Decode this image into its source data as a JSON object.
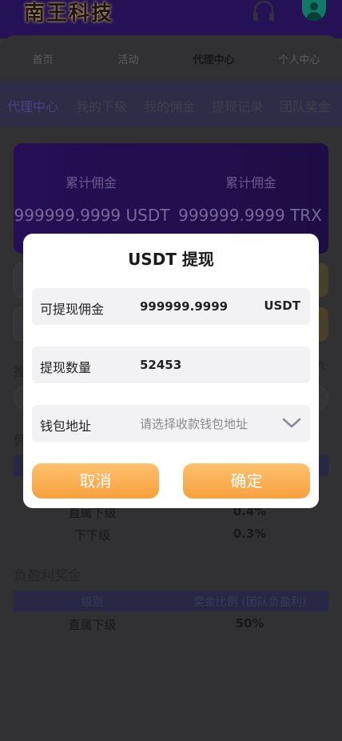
{
  "header": {
    "logo_text": "南王科技",
    "support_icon": "headset-icon",
    "avatar_icon": "user-avatar-icon"
  },
  "nav": {
    "items": [
      {
        "label": "首页"
      },
      {
        "label": "活动"
      },
      {
        "label": "代理中心",
        "active": true
      },
      {
        "label": "个人中心"
      }
    ]
  },
  "subtabs": {
    "items": [
      {
        "label": "代理中心",
        "active": true
      },
      {
        "label": "我的下级"
      },
      {
        "label": "我的佣金"
      },
      {
        "label": "提现记录"
      },
      {
        "label": "团队奖金"
      }
    ]
  },
  "stats": {
    "left": {
      "label": "累计佣金",
      "value": "999999.9999 USDT"
    },
    "right": {
      "label": "累计佣金",
      "value": "999999.9999 TRX"
    }
  },
  "background": {
    "row3_prefix": "推",
    "row3_suffix": "VL",
    "section1_prefix": "佣",
    "commission_rows": [
      {
        "level": "直属下级",
        "rate": "0.4%"
      },
      {
        "level": "下下级",
        "rate": "0.3%"
      }
    ],
    "section2_title": "负盈利奖金",
    "section2_headers": [
      "级别",
      "奖金比例 (团队负盈利)"
    ],
    "section2_rows": [
      {
        "level": "直属下级",
        "rate": "50%"
      }
    ]
  },
  "modal": {
    "title": "USDT 提现",
    "fields": {
      "commission": {
        "label": "可提现佣金",
        "value": "999999.9999",
        "unit": "USDT"
      },
      "amount": {
        "label": "提现数量",
        "value": "52453"
      },
      "wallet": {
        "label": "钱包地址",
        "placeholder": "请选择收款钱包地址"
      }
    },
    "cancel_label": "取消",
    "confirm_label": "确定",
    "accent": "#f7a03d"
  }
}
